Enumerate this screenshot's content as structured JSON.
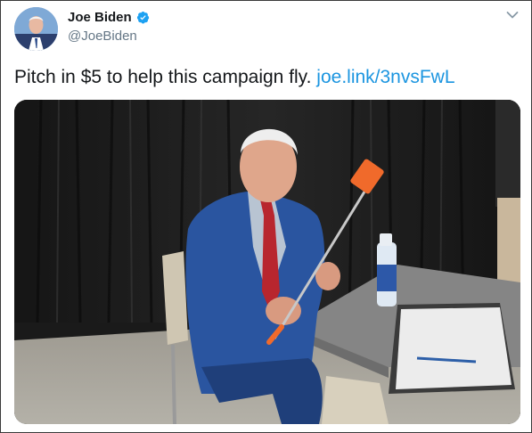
{
  "tweet": {
    "author": {
      "display_name": "Joe Biden",
      "handle": "@JoeBiden",
      "verified": true,
      "avatar_icon": "profile-photo"
    },
    "text": "Pitch in $5 to help this campaign fly. ",
    "link_text": "joe.link/3nvsFwL",
    "media": {
      "type": "photo"
    }
  },
  "colors": {
    "link": "#1b95e0",
    "verified": "#1da1f2",
    "name": "#14171a",
    "handle": "#657786",
    "border": "#3a3a3a"
  },
  "icons": {
    "more": "chevron-down-icon",
    "verified": "verified-badge-icon"
  }
}
